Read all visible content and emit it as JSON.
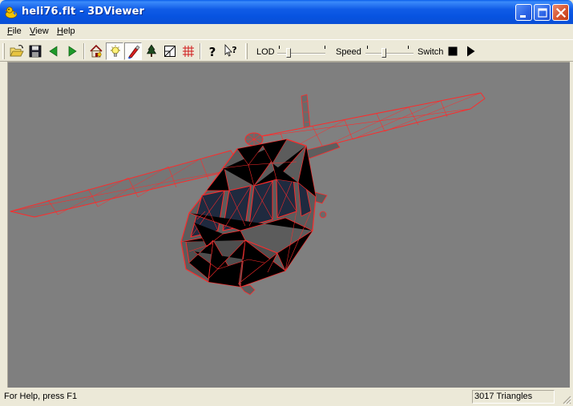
{
  "window": {
    "title": "heli76.flt - 3DViewer",
    "icon": "rubber-duck-icon",
    "buttons": [
      "minimize-icon",
      "maximize-icon",
      "close-icon"
    ]
  },
  "menu": {
    "file": "File",
    "view": "View",
    "help": "Help"
  },
  "toolbar": {
    "buttons": [
      {
        "icon": "open-folder-icon",
        "pressed": false
      },
      {
        "icon": "save-icon",
        "pressed": false
      },
      {
        "icon": "back-arrow-icon",
        "pressed": false
      },
      {
        "icon": "forward-arrow-icon",
        "pressed": false
      },
      {
        "icon": "home-view-icon",
        "pressed": false
      },
      {
        "icon": "lighting-icon",
        "pressed": true
      },
      {
        "icon": "texture-paint-icon",
        "pressed": true
      },
      {
        "icon": "tree-icon",
        "pressed": false
      },
      {
        "icon": "bounding-box-icon",
        "pressed": false
      },
      {
        "icon": "grid-icon",
        "pressed": false
      },
      {
        "icon": "about-icon",
        "pressed": false
      },
      {
        "icon": "context-help-icon",
        "pressed": false
      },
      {
        "icon": "stop-icon",
        "pressed": false
      },
      {
        "icon": "play-icon",
        "pressed": false
      }
    ],
    "lod_label": "LOD",
    "lod_value": 0.2,
    "speed_label": "Speed",
    "speed_value": 0.35,
    "switch_label": "Switch"
  },
  "viewport": {
    "background": "#7F7F7F",
    "wire_color": "#FF2A2A",
    "body_color": "#5C5C5C",
    "glass_color": "#1F2A3F"
  },
  "status": {
    "help": "For Help, press F1",
    "triangles": "3017 Triangles"
  }
}
